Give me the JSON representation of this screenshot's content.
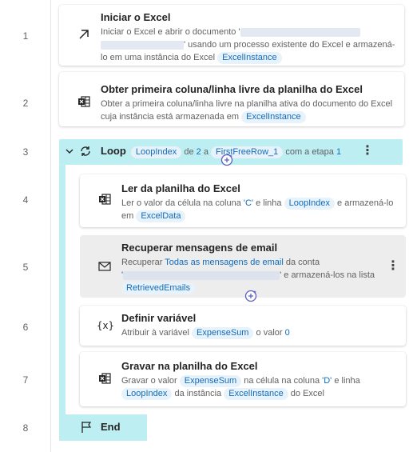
{
  "line_numbers": [
    "1",
    "2",
    "3",
    "4",
    "5",
    "6",
    "7",
    "8"
  ],
  "steps": {
    "s1": {
      "title": "Iniciar o Excel",
      "d1": "Iniciar o Excel e abrir o documento '",
      "d2": "' usando um processo existente do Excel e armazená-lo em uma instância do Excel",
      "var": "ExcelInstance",
      "icon": "arrow-up-right-icon"
    },
    "s2": {
      "title": "Obter primeira coluna/linha livre da planilha do Excel",
      "d1": "Obter a primeira coluna/linha livre na planilha ativa do documento do Excel cuja instância está armazenada em",
      "var": "ExcelInstance",
      "icon": "excel-icon"
    },
    "loop": {
      "label": "Loop",
      "var": "LoopIndex",
      "de": "de",
      "start": "2",
      "a": "a",
      "end_var": "FirstFreeRow_1",
      "step_text": "com a etapa",
      "step": "1"
    },
    "s4": {
      "title": "Ler da planilha do Excel",
      "d1": "Ler o valor da célula na coluna",
      "col": "'C'",
      "d2": "e linha",
      "var1": "LoopIndex",
      "d3": "e armazená-lo em",
      "var2": "ExcelData",
      "icon": "excel-icon"
    },
    "s5": {
      "title": "Recuperar mensagens de email",
      "d1": "Recuperar",
      "link": "Todas as mensagens de email",
      "d2": "da conta",
      "d3": "' e armazená-los na lista",
      "quote": "'",
      "var": "RetrievedEmails",
      "icon": "mail-icon"
    },
    "s6": {
      "title": "Definir variável",
      "d1": "Atribuir à variável",
      "var": "ExpenseSum",
      "d2": "o valor",
      "val": "0",
      "icon": "variable-icon"
    },
    "s7": {
      "title": "Gravar na planilha do Excel",
      "d1": "Gravar o valor",
      "var1": "ExpenseSum",
      "d2": "na célula na coluna",
      "col": "'D'",
      "d3": "e linha",
      "var2": "LoopIndex",
      "d4": "da instância",
      "var3": "ExcelInstance",
      "d5": "do Excel",
      "icon": "excel-icon"
    },
    "end": {
      "label": "End",
      "icon": "flag-icon"
    }
  },
  "colors": {
    "loop_bg": "#bdeef2",
    "token_bg": "#e8f2fb",
    "token_text": "#0f6cbd"
  }
}
